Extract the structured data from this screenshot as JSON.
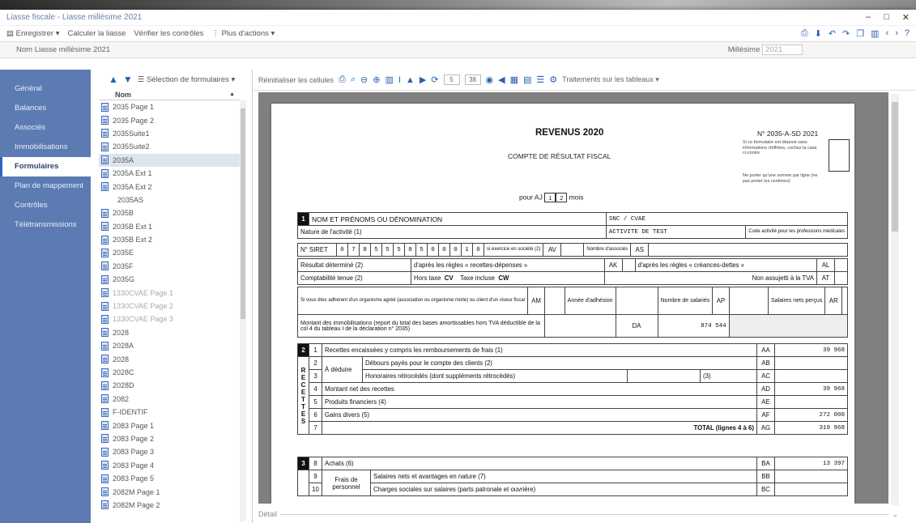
{
  "window": {
    "title": "Liasse fiscale - Liasse millésime 2021",
    "controls": [
      "–",
      "□",
      "✕"
    ]
  },
  "commands": {
    "save": "Enregistrer",
    "calculate": "Calculer la liasse",
    "verify": "Vérifier les contrôles",
    "more_actions": "Plus d'actions"
  },
  "namebar": {
    "name_label": "Nom",
    "name_value": "Liasse millésime 2021",
    "millesime_label": "Millésime",
    "millesime_value": "2021"
  },
  "sidebar": {
    "items": [
      {
        "label": "Général"
      },
      {
        "label": "Balances"
      },
      {
        "label": "Associés"
      },
      {
        "label": "Immobilisations"
      },
      {
        "label": "Formulaires"
      },
      {
        "label": "Plan de mappement"
      },
      {
        "label": "Contrôles"
      },
      {
        "label": "Télétransmissions"
      }
    ],
    "active_index": 4
  },
  "formpanel": {
    "selector_label": "Sélection de formulaires",
    "column_header": "Nom",
    "items": [
      "2035 Page 1",
      "2035 Page 2",
      "2035Suite1",
      "2035Suite2",
      "2035A",
      "2035A Ext 1",
      "2035A Ext 2",
      "2035AS",
      "2035B",
      "2035B Ext 1",
      "2035B Ext 2",
      "2035E",
      "2035F",
      "2035G",
      "1330CVAE Page 1",
      "1330CVAE Page 2",
      "1330CVAE Page 3",
      "2028",
      "2028A",
      "2028",
      "2028C",
      "2028D",
      "2082",
      "F-IDENTIF",
      "2083 Page 1",
      "2083 Page 2",
      "2083 Page 3",
      "2083 Page 4",
      "2083 Page 5",
      "2082M Page 1",
      "2082M Page 2"
    ],
    "selected_index": 4,
    "noicon_indices": [
      7
    ],
    "dim_indices": [
      14,
      15,
      16
    ]
  },
  "viewer": {
    "toolbar_label": "Réinitialiser les cellules",
    "page_current": "5",
    "page_total": "38",
    "tables_label": "Traitements sur les tableaux",
    "detail_label": "Détail"
  },
  "doc": {
    "title": "REVENUS 2020",
    "subtitle": "COMPTE DE RÉSULTAT FISCAL",
    "form_number": "N° 2035-A-SD 2021",
    "note1": "Si ce formulaire est déposé sans informations chiffrées, cochez la case ci-contre",
    "note2": "Ne porter qu'une somme par ligne (ne pas porter les centimes)",
    "pour": "pour",
    "aj": "AJ",
    "aj_digits": [
      "1",
      "2"
    ],
    "mois": "mois",
    "s1_num": "1",
    "s1_label": "NOM ET PRÉNOMS OU DÉNOMINATION",
    "s1_value": "SNC / CVAE",
    "nature_label": "Nature de l'activité (1)",
    "nature_value": "ACTIVITE DE TEST",
    "code_activite": "Code activité pour les professions médicales",
    "siret_label": "N° SIRET",
    "siret_digits": [
      "0",
      "7",
      "8",
      "5",
      "5",
      "5",
      "8",
      "5",
      "0",
      "0",
      "0",
      "1",
      "0"
    ],
    "si_exercice": "si exercice en société (2)",
    "av": "AV",
    "nombre_associes": "Nombre d'associés",
    "as": "AS",
    "resultat_label": "Résultat déterminé (2)",
    "recettes_depenses": "d'après les règles « recettes-dépenses »",
    "ak": "AK",
    "creances_dettes": "d'après les règles « créances-dettes »",
    "al": "AL",
    "compta_label": "Comptabilité tenue (2)",
    "hors_taxe": "Hors taxe",
    "cv": "CV",
    "taxe_incluse": "Taxe incluse",
    "cw": "CW",
    "non_assujetti": "Non assujetti à la TVA",
    "at": "AT",
    "adherent": "Si vous êtes adhérent d'un organisme agréé (association ou organisme mixte) ou client d'un viseur fiscal",
    "am": "AM",
    "annee_adhesion": "Année d'adhésion",
    "nombre_salaries": "Nombre de salariés",
    "ap": "AP",
    "salaires_nets": "Salaires nets perçus",
    "ar": "AR",
    "montant_immo": "Montant des immobilisations (report du total des bases amortissables hors TVA déductible de la col 4 du tableau I de la déclaration n° 2035)",
    "da": "DA",
    "da_value": "874 544",
    "s2_num": "2",
    "recettes_vert": [
      "R",
      "E",
      "C",
      "E",
      "T",
      "T",
      "E",
      "S"
    ],
    "a_deduire": "À déduire",
    "s2_rows": [
      {
        "n": "1",
        "label": "Recettes encaissées y compris les remboursements de frais (1)",
        "code": "AA",
        "value": "39 968"
      },
      {
        "n": "2",
        "label": "Débours payés pour le compte des clients (2)",
        "code": "AB",
        "value": ""
      },
      {
        "n": "3",
        "label": "Honoraires rétrocédés (dont suppléments rétrocédés)",
        "code": "AC",
        "value": ""
      },
      {
        "n": "4",
        "label": "Montant net des recettes",
        "code": "AD",
        "value": "39 968"
      },
      {
        "n": "5",
        "label": "Produits financiers (4)",
        "code": "AE",
        "value": ""
      },
      {
        "n": "6",
        "label": "Gains divers (5)",
        "code": "AF",
        "value": "272 000"
      },
      {
        "n": "7",
        "label": "TOTAL (lignes 4 à 6)",
        "code": "AG",
        "value": "319 968"
      }
    ],
    "row3_paren": "(3)",
    "s3_num": "3",
    "frais_personnel": "Frais de personnel",
    "s3_rows": [
      {
        "n": "8",
        "label": "Achats (6)",
        "code": "BA",
        "value": "13 397"
      },
      {
        "n": "9",
        "label": "Salaires nets et avantages en nature (7)",
        "code": "BB",
        "value": ""
      },
      {
        "n": "10",
        "label": "Charges sociales sur salaires (parts patronale et ouvrière)",
        "code": "BC",
        "value": ""
      }
    ]
  }
}
